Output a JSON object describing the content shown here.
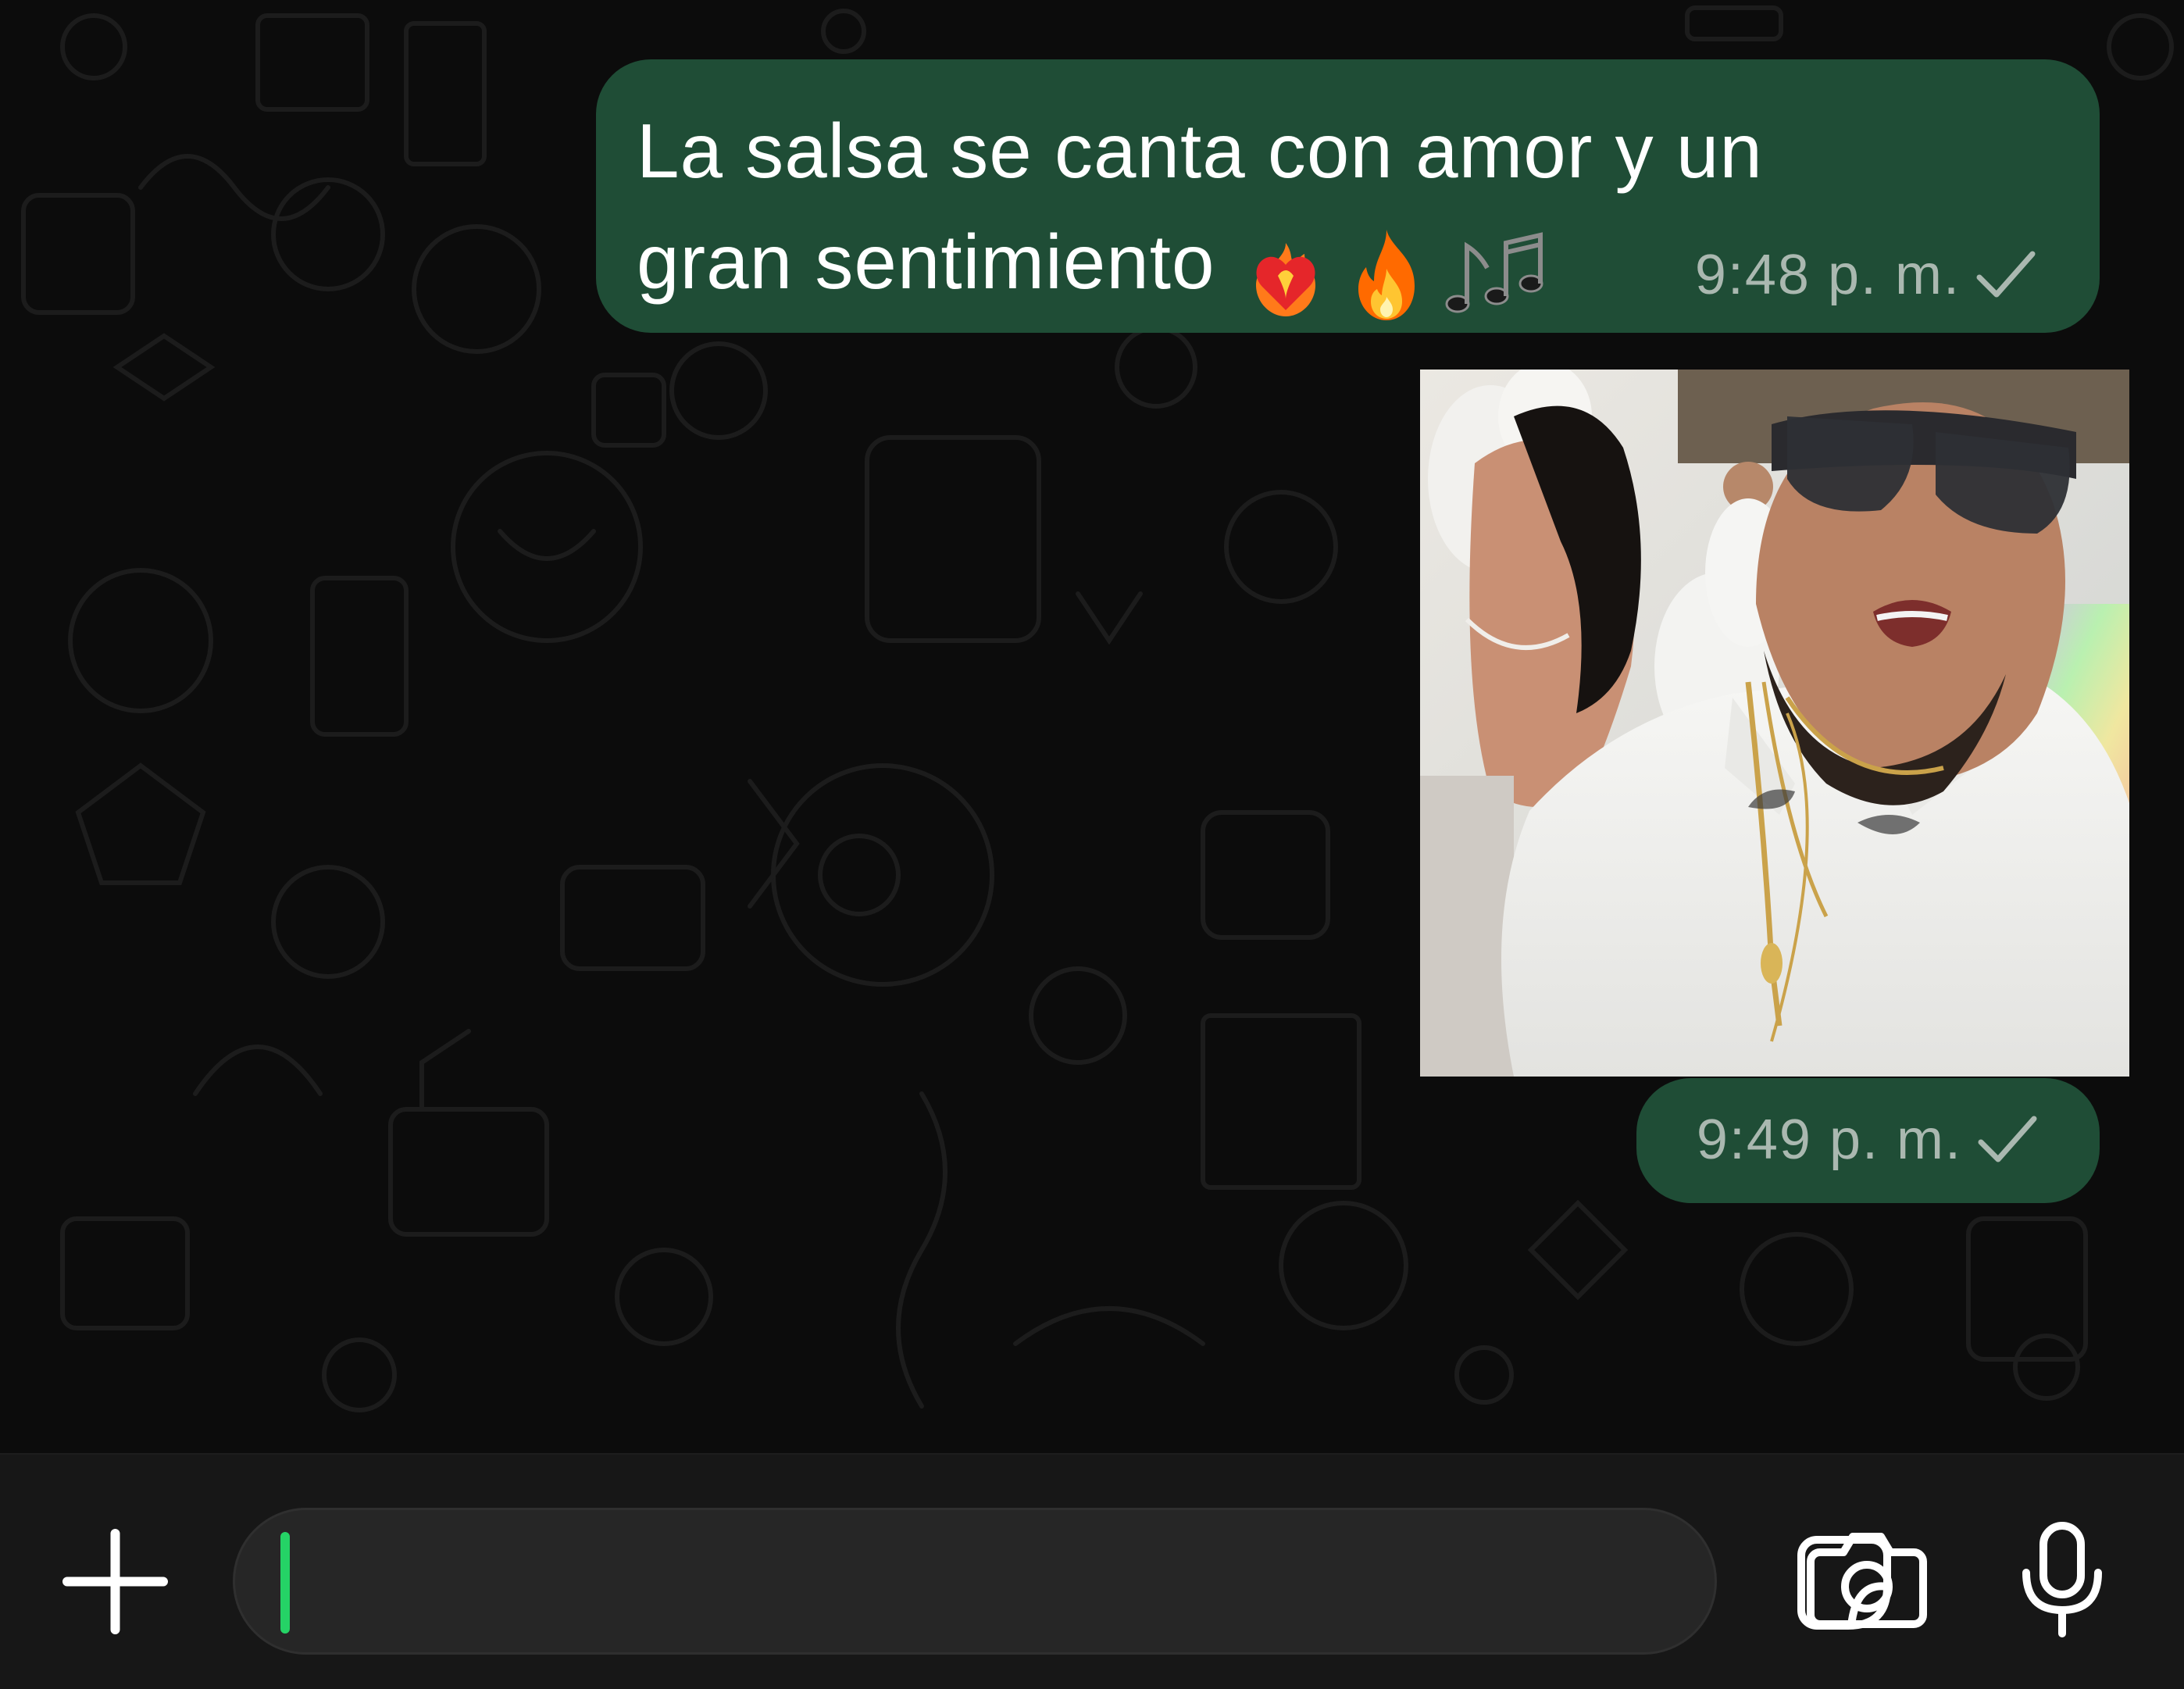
{
  "theme": {
    "bubble_color": "#1f4d36",
    "background": "#0c0c0c",
    "accent": "#25d366"
  },
  "messages": [
    {
      "type": "text",
      "text": "La salsa se canta con amor y un gran sentimiento",
      "emojis": [
        "heart-on-fire-emoji",
        "fire-emoji",
        "musical-notes-emoji"
      ],
      "time": "9:48 p. m.",
      "status": "sent-check"
    },
    {
      "type": "image",
      "image_description_icon": "photo-thumbnail",
      "time": "9:49 p. m.",
      "status": "sent-check"
    }
  ],
  "composer": {
    "input_value": "",
    "icons": {
      "attach": "plus-icon",
      "sticker": "sticker-icon",
      "camera": "camera-icon",
      "voice": "microphone-icon"
    }
  }
}
